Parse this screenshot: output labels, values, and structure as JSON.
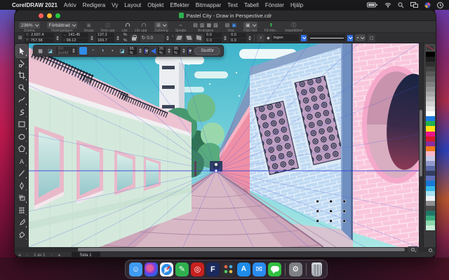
{
  "menubar": {
    "apple_logo": "",
    "app_name": "CorelDRAW 2021",
    "items": [
      "Arkiv",
      "Redigera",
      "Vy",
      "Layout",
      "Objekt",
      "Effekter",
      "Bitmappar",
      "Text",
      "Tabell",
      "Fönster",
      "Hjälp"
    ],
    "status_icons": [
      "battery-icon",
      "wifi-icon",
      "search-icon",
      "screen-mirroring-icon",
      "control-center-icon",
      "clock-icon"
    ]
  },
  "window": {
    "title": "Pastel City - Draw in Perspective.cdr"
  },
  "toolbar": {
    "zoom_value": "236%",
    "zoom_label": "Zooma",
    "view_value": "Förbättrad",
    "view_label": "Visningslägen",
    "group_label": "Grupp",
    "ungroup_label": "Dela upp",
    "lock_label": "Lås",
    "unlock_label": "Lås upp",
    "align_label": "Justering",
    "mirror_label": "Spegla",
    "arrange_label": "Arrangera",
    "show_label": "Visa",
    "snap_label": "Fäst mot",
    "getmore_label": "Få mer...",
    "inspectors_label": "Inspektörer"
  },
  "icons": {
    "group": "▣",
    "ungroup": "◫",
    "align": "⊞",
    "mirror": "⇔",
    "arrange_1": "▤",
    "arrange_2": "▥",
    "arrange_3": "▦",
    "arrange_4": "▧",
    "show_1": "▤",
    "show_2": "▣",
    "snap": "▣",
    "getmore": "⬆",
    "inspectors": "ⓘ",
    "arrow_h": "↔",
    "arrow_v": "↕",
    "rotate": "↻",
    "origin": "⊞",
    "flash": "⚡",
    "drop": "◆",
    "corner": "▢",
    "grid": "▦",
    "eraser": "◪",
    "sphere_a": "◔",
    "sphere_b": "◑",
    "dot": "▪"
  },
  "property_bar": {
    "x_label": "X:",
    "x_value": "2,697.4",
    "y_label": "Y:",
    "y_value": "757.58",
    "width_value": "141.45",
    "height_value": "99.12",
    "scale_x": "137.2",
    "scale_y": "169.7",
    "percent": "%",
    "rotation_value": "0.0",
    "degree": "°",
    "skew_x": "0.0",
    "skew_y": "0.0",
    "pos2_x": "0.0",
    "pos2_y": "0.0",
    "outline_value": "Ingen"
  },
  "perspective_bar": {
    "preset_value": "En punkt",
    "fill_swatch": "#2f8de8",
    "opacity_value": "95 %",
    "swatch1": "#2222dd",
    "value2": "20 %",
    "value3": "85 %",
    "swatch2": "#12127e",
    "finish_label": "Slutför"
  },
  "toolbox": {
    "tools": [
      "pick-tool",
      "shape-tool",
      "crop-tool",
      "zoom-tool",
      "freehand-tool",
      "artistic-media-tool",
      "rectangle-tool",
      "ellipse-tool",
      "polygon-tool",
      "text-tool",
      "line-tool",
      "pen-tool",
      "interactive-fill-tool",
      "mesh-fill-tool",
      "eyedropper-tool",
      "fill-tool"
    ],
    "selected": "pick-tool"
  },
  "statusbar": {
    "add_page": "+",
    "prev": "‹",
    "page_info": "1 av 1",
    "next": "›",
    "page_tab": "Sida 1"
  },
  "palette": {
    "swatches": [
      "#ffffff",
      "#000000",
      "#1c1c1c",
      "#303030",
      "#444444",
      "#585858",
      "#6c6c6c",
      "#808080",
      "#949494",
      "#a8a8a8",
      "#bcbcbc",
      "#d0d0d0",
      "#e4e4e4",
      "#ffffff",
      "#1f7ae0",
      "#22b14c",
      "#ffe215",
      "#e8148c",
      "#d41a2a",
      "#8a2c9e",
      "#f07820",
      "#f8b8c8",
      "#c8c8e8",
      "#9098cc",
      "#5a68a4",
      "#343c60",
      "#6070b8",
      "#1878d8",
      "#38b8e8",
      "#a8e0f0",
      "#eef2f4",
      "#8e8e8e",
      "#4a4a4a",
      "#1f7868",
      "#3aa87c",
      "#8cd8ac",
      "#c8ecd8"
    ]
  },
  "dock": {
    "apps": [
      {
        "name": "finder",
        "color": "#3f9af2",
        "glyph": "☺"
      },
      {
        "name": "siri",
        "color": "#14142a",
        "glyph": ""
      },
      {
        "name": "safari",
        "color": "#f2f4f6",
        "glyph": ""
      },
      {
        "name": "coreldraw",
        "color": "#2faf4e",
        "glyph": "✎"
      },
      {
        "name": "corel-capture",
        "color": "#c8201e",
        "glyph": "◎"
      },
      {
        "name": "font-manager",
        "color": "#1b2a5e",
        "glyph": "F"
      },
      {
        "name": "launchpad",
        "color": "#2e2e33",
        "glyph": ""
      },
      {
        "name": "app-store",
        "color": "#1e8ce8",
        "glyph": "A"
      },
      {
        "name": "mail",
        "color": "#2a8cf0",
        "glyph": "✉"
      },
      {
        "name": "messages",
        "color": "#30c040",
        "glyph": ""
      },
      {
        "name": "system-preferences",
        "color": "#7e8084",
        "glyph": "⚙"
      },
      {
        "name": "trash",
        "color": "#b0b4ba",
        "glyph": ""
      }
    ]
  },
  "artwork": {
    "title": "Pastel City perspective street scene",
    "colors": {
      "sky_top": "#3fb4cc",
      "sky_bottom": "#a9e8e6",
      "mint_wall": "#d4e9dc",
      "pink_band": "#edc3d2",
      "window_frame": "#e9b9ca",
      "window_glass": "#9ccfd0",
      "tree_dark": "#2f7354",
      "tree_light": "#9ad8ac",
      "road": "#cda6ba",
      "road_light": "#d9b8c6",
      "colonnade_pink": "#ef8fa6",
      "blue_brick": "#bfd9f2",
      "pilaster": "#6f8fc0",
      "pink_brick": "#f9c6dc",
      "ring_pink": "#f5a9cb",
      "oval_dark": "#172441",
      "guide_blue": "#2f3cdc"
    }
  }
}
